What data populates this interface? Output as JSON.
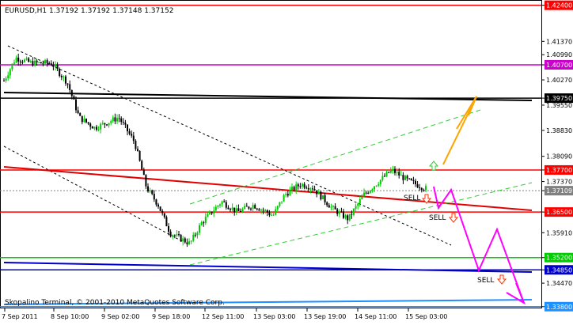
{
  "header": {
    "symbol_line": "EURUSD,H1  1.37192 1.37192 1.37148 1.37152"
  },
  "footer": {
    "copyright": "Skopalino Terminal, © 2001-2010 MetaQuotes Software Corp."
  },
  "axes": {
    "price_ticks": [
      "1.42400",
      "1.41370",
      "1.40990",
      "1.40700",
      "1.40270",
      "1.39750",
      "1.39550",
      "1.38830",
      "1.38090",
      "1.37700",
      "1.37370",
      "1.37109",
      "1.36500",
      "1.35910",
      "1.35200",
      "1.34850",
      "1.34470",
      "1.33800"
    ],
    "time_labels": [
      "7 Sep 2011",
      "8 Sep 10:00",
      "9 Sep 02:00",
      "9 Sep 18:00",
      "12 Sep 11:00",
      "13 Sep 03:00",
      "13 Sep 19:00",
      "14 Sep 11:00",
      "15 Sep 03:00"
    ]
  },
  "annotations": {
    "sell_1": "SELL",
    "sell_2": "SELL",
    "sell_3": "SELL"
  },
  "chart_data": {
    "type": "candlestick",
    "symbol": "EURUSD",
    "timeframe": "H1",
    "last_bar": {
      "open": 1.37192,
      "high": 1.37192,
      "low": 1.37148,
      "close": 1.37152
    },
    "y_range": [
      1.3375,
      1.4255
    ],
    "x_labels": [
      "7 Sep 2011",
      "8 Sep 10:00",
      "9 Sep 02:00",
      "9 Sep 18:00",
      "12 Sep 11:00",
      "13 Sep 03:00",
      "13 Sep 19:00",
      "14 Sep 11:00",
      "15 Sep 03:00"
    ],
    "horizontal_levels": [
      {
        "price": 1.424,
        "color": "#ff0000",
        "highlighted": true
      },
      {
        "price": 1.407,
        "color": "#cc00cc",
        "highlighted": true
      },
      {
        "price": 1.3975,
        "color": "#000000",
        "highlighted": true
      },
      {
        "price": 1.377,
        "color": "#ff0000",
        "highlighted": true
      },
      {
        "price": 1.37109,
        "color": "#808080",
        "highlighted": true,
        "current": true
      },
      {
        "price": 1.365,
        "color": "#ff0000",
        "highlighted": true
      },
      {
        "price": 1.352,
        "color": "#00cc00",
        "highlighted": true
      },
      {
        "price": 1.3485,
        "color": "#0000cc",
        "highlighted": true
      },
      {
        "price": 1.338,
        "color": "#1e90ff",
        "highlighted": true
      }
    ],
    "colors": {
      "bull_candle": "#00cc00",
      "bear_candle": "#000000",
      "trend_lines": "#ff0000",
      "channel": "#33cc33",
      "target_up": "#ffa500",
      "target_down": "#ff00ff",
      "sell_arrow": "#ff3300",
      "up_arrow": "#33cc33"
    }
  }
}
